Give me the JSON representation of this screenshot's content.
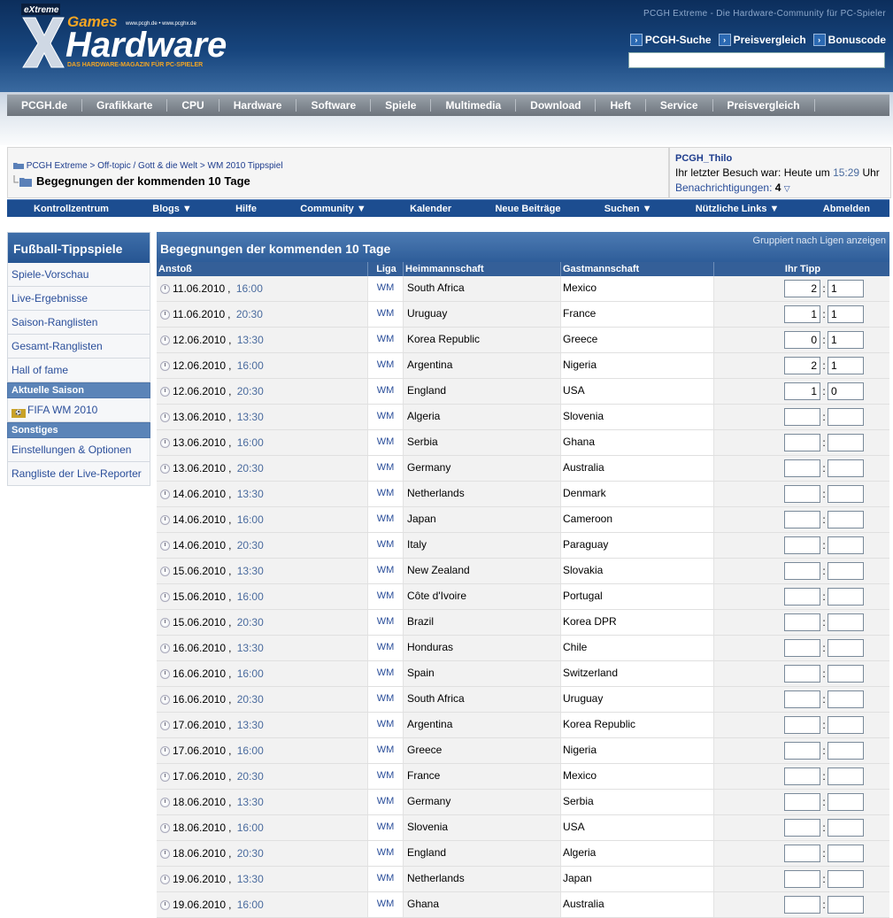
{
  "header": {
    "tagline": "PCGH Extreme - Die Hardware-Community für PC-Spieler",
    "logo": {
      "extreme": "eXtreme",
      "games": "Games",
      "brand": "Hardware",
      "urls": "www.pcgh.de • www.pcghx.de",
      "sub": "DAS HARDWARE-MAGAZIN FÜR PC-SPIELER"
    },
    "links": [
      "PCGH-Suche",
      "Preisvergleich",
      "Bonuscode"
    ],
    "search_value": ""
  },
  "mainnav": [
    "PCGH.de",
    "Grafikkarte",
    "CPU",
    "Hardware",
    "Software",
    "Spiele",
    "Multimedia",
    "Download",
    "Heft",
    "Service",
    "Preisvergleich"
  ],
  "breadcrumb": {
    "items": [
      "PCGH Extreme",
      "Off-topic / Gott & die Welt",
      "WM 2010 Tippspiel"
    ],
    "sep": " > ",
    "title": "Begegnungen der kommenden 10 Tage"
  },
  "user": {
    "name": "PCGH_Thilo",
    "last_visit_prefix": "Ihr letzter Besuch war: Heute um ",
    "last_visit_time": "15:29",
    "last_visit_suffix": " Uhr",
    "notifications_label": "Benachrichtigungen:",
    "notifications_count": "4"
  },
  "bluenav": [
    "Kontrollzentrum",
    "Blogs ▼",
    "Hilfe",
    "Community ▼",
    "Kalender",
    "Neue Beiträge",
    "Suchen ▼",
    "Nützliche Links ▼",
    "Abmelden"
  ],
  "sidebar": {
    "title": "Fußball-Tippspiele",
    "items1": [
      "Spiele-Vorschau",
      "Live-Ergebnisse",
      "Saison-Ranglisten",
      "Gesamt-Ranglisten",
      "Hall of fame"
    ],
    "section1": "Aktuelle Saison",
    "season": "FIFA WM 2010",
    "section2": "Sonstiges",
    "items2": [
      "Einstellungen & Optionen",
      "Rangliste der Live-Reporter"
    ]
  },
  "main": {
    "title": "Begegnungen der kommenden 10 Tage",
    "group_link": "Gruppiert nach Ligen anzeigen",
    "columns": [
      "Anstoß",
      "Liga",
      "Heimmannschaft",
      "Gastmannschaft",
      "Ihr Tipp"
    ],
    "rows": [
      {
        "date": "11.06.2010",
        "time": "16:00",
        "liga": "WM",
        "home": "South Africa",
        "away": "Mexico",
        "th": "2",
        "ta": "1"
      },
      {
        "date": "11.06.2010",
        "time": "20:30",
        "liga": "WM",
        "home": "Uruguay",
        "away": "France",
        "th": "1",
        "ta": "1"
      },
      {
        "date": "12.06.2010",
        "time": "13:30",
        "liga": "WM",
        "home": "Korea Republic",
        "away": "Greece",
        "th": "0",
        "ta": "1"
      },
      {
        "date": "12.06.2010",
        "time": "16:00",
        "liga": "WM",
        "home": "Argentina",
        "away": "Nigeria",
        "th": "2",
        "ta": "1"
      },
      {
        "date": "12.06.2010",
        "time": "20:30",
        "liga": "WM",
        "home": "England",
        "away": "USA",
        "th": "1",
        "ta": "0"
      },
      {
        "date": "13.06.2010",
        "time": "13:30",
        "liga": "WM",
        "home": "Algeria",
        "away": "Slovenia",
        "th": "",
        "ta": ""
      },
      {
        "date": "13.06.2010",
        "time": "16:00",
        "liga": "WM",
        "home": "Serbia",
        "away": "Ghana",
        "th": "",
        "ta": ""
      },
      {
        "date": "13.06.2010",
        "time": "20:30",
        "liga": "WM",
        "home": "Germany",
        "away": "Australia",
        "th": "",
        "ta": ""
      },
      {
        "date": "14.06.2010",
        "time": "13:30",
        "liga": "WM",
        "home": "Netherlands",
        "away": "Denmark",
        "th": "",
        "ta": ""
      },
      {
        "date": "14.06.2010",
        "time": "16:00",
        "liga": "WM",
        "home": "Japan",
        "away": "Cameroon",
        "th": "",
        "ta": ""
      },
      {
        "date": "14.06.2010",
        "time": "20:30",
        "liga": "WM",
        "home": "Italy",
        "away": "Paraguay",
        "th": "",
        "ta": ""
      },
      {
        "date": "15.06.2010",
        "time": "13:30",
        "liga": "WM",
        "home": "New Zealand",
        "away": "Slovakia",
        "th": "",
        "ta": ""
      },
      {
        "date": "15.06.2010",
        "time": "16:00",
        "liga": "WM",
        "home": "Côte d'Ivoire",
        "away": "Portugal",
        "th": "",
        "ta": ""
      },
      {
        "date": "15.06.2010",
        "time": "20:30",
        "liga": "WM",
        "home": "Brazil",
        "away": "Korea DPR",
        "th": "",
        "ta": ""
      },
      {
        "date": "16.06.2010",
        "time": "13:30",
        "liga": "WM",
        "home": "Honduras",
        "away": "Chile",
        "th": "",
        "ta": ""
      },
      {
        "date": "16.06.2010",
        "time": "16:00",
        "liga": "WM",
        "home": "Spain",
        "away": "Switzerland",
        "th": "",
        "ta": ""
      },
      {
        "date": "16.06.2010",
        "time": "20:30",
        "liga": "WM",
        "home": "South Africa",
        "away": "Uruguay",
        "th": "",
        "ta": ""
      },
      {
        "date": "17.06.2010",
        "time": "13:30",
        "liga": "WM",
        "home": "Argentina",
        "away": "Korea Republic",
        "th": "",
        "ta": ""
      },
      {
        "date": "17.06.2010",
        "time": "16:00",
        "liga": "WM",
        "home": "Greece",
        "away": "Nigeria",
        "th": "",
        "ta": ""
      },
      {
        "date": "17.06.2010",
        "time": "20:30",
        "liga": "WM",
        "home": "France",
        "away": "Mexico",
        "th": "",
        "ta": ""
      },
      {
        "date": "18.06.2010",
        "time": "13:30",
        "liga": "WM",
        "home": "Germany",
        "away": "Serbia",
        "th": "",
        "ta": ""
      },
      {
        "date": "18.06.2010",
        "time": "16:00",
        "liga": "WM",
        "home": "Slovenia",
        "away": "USA",
        "th": "",
        "ta": ""
      },
      {
        "date": "18.06.2010",
        "time": "20:30",
        "liga": "WM",
        "home": "England",
        "away": "Algeria",
        "th": "",
        "ta": ""
      },
      {
        "date": "19.06.2010",
        "time": "13:30",
        "liga": "WM",
        "home": "Netherlands",
        "away": "Japan",
        "th": "",
        "ta": ""
      },
      {
        "date": "19.06.2010",
        "time": "16:00",
        "liga": "WM",
        "home": "Ghana",
        "away": "Australia",
        "th": "",
        "ta": ""
      }
    ]
  },
  "colors": {
    "brand_blue": "#1c4d90",
    "header_dark": "#0c2e5c",
    "link": "#2a4e9a",
    "logo_orange": "#f5a623"
  }
}
